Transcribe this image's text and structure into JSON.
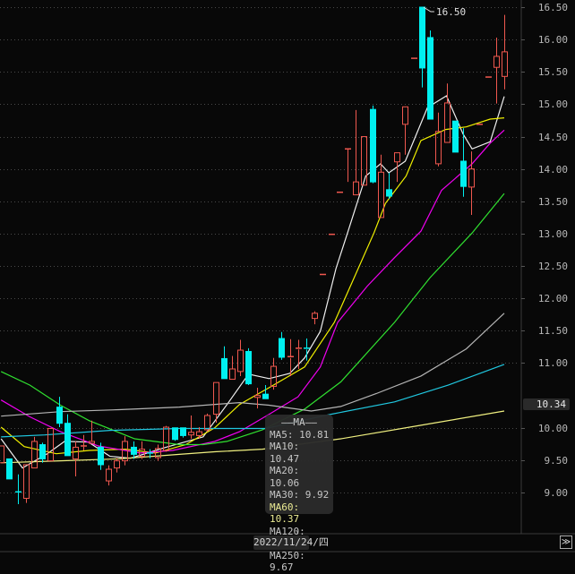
{
  "chart_data": {
    "type": "candlestick",
    "ylim": [
      8.7,
      16.62
    ],
    "yticks": [
      "16.50",
      "16.00",
      "15.50",
      "15.00",
      "14.50",
      "14.00",
      "13.50",
      "13.00",
      "12.50",
      "12.00",
      "11.50",
      "11.00",
      "10.00",
      "9.50",
      "9.00"
    ],
    "grid": true,
    "colors": {
      "up": "#f0584f",
      "down": "#00f0f0",
      "background": "#080808",
      "grid": "#4a4a4a"
    },
    "candles_ohlc": [
      [
        9.46,
        9.72,
        9.46,
        9.72
      ],
      [
        9.52,
        9.52,
        9.21,
        9.21
      ],
      [
        9.01,
        9.28,
        8.82,
        9.0
      ],
      [
        8.91,
        9.43,
        8.84,
        9.43
      ],
      [
        9.38,
        9.86,
        9.38,
        9.79
      ],
      [
        9.74,
        9.77,
        9.46,
        9.52
      ],
      [
        9.49,
        9.99,
        9.49,
        9.99
      ],
      [
        10.32,
        10.48,
        10.01,
        10.07
      ],
      [
        10.07,
        10.21,
        9.57,
        9.57
      ],
      [
        9.52,
        9.79,
        9.25,
        9.7
      ],
      [
        9.71,
        9.89,
        9.65,
        9.72
      ],
      [
        9.76,
        10.11,
        9.76,
        9.79
      ],
      [
        9.7,
        9.77,
        9.35,
        9.43
      ],
      [
        9.18,
        9.42,
        9.11,
        9.36
      ],
      [
        9.38,
        9.53,
        9.31,
        9.49
      ],
      [
        9.49,
        9.87,
        9.42,
        9.79
      ],
      [
        9.7,
        9.79,
        9.52,
        9.59
      ],
      [
        9.56,
        9.79,
        9.52,
        9.67
      ],
      [
        9.61,
        9.67,
        9.53,
        9.6
      ],
      [
        9.54,
        9.74,
        9.49,
        9.68
      ],
      [
        9.65,
        10.03,
        9.63,
        10.01
      ],
      [
        10.0,
        10.0,
        9.8,
        9.82
      ],
      [
        10.0,
        10.0,
        9.85,
        9.88
      ],
      [
        9.89,
        10.19,
        9.83,
        9.93
      ],
      [
        9.88,
        10.01,
        9.83,
        9.94
      ],
      [
        9.97,
        10.22,
        9.94,
        10.19
      ],
      [
        10.21,
        10.7,
        10.08,
        10.7
      ],
      [
        11.07,
        11.26,
        10.76,
        10.76
      ],
      [
        10.75,
        11.11,
        10.75,
        10.91
      ],
      [
        10.87,
        11.36,
        10.8,
        11.2
      ],
      [
        11.18,
        11.23,
        10.66,
        10.68
      ],
      [
        10.47,
        10.62,
        10.3,
        10.5
      ],
      [
        10.52,
        10.66,
        10.45,
        10.45
      ],
      [
        10.64,
        11.08,
        10.59,
        10.95
      ],
      [
        11.38,
        11.48,
        11.05,
        11.09
      ],
      [
        11.08,
        11.37,
        10.8,
        11.1
      ],
      [
        11.21,
        11.36,
        10.91,
        11.23
      ],
      [
        11.23,
        11.38,
        11.04,
        11.21
      ],
      [
        11.69,
        11.8,
        11.6,
        11.77
      ],
      [
        12.37,
        12.37,
        12.37,
        12.37
      ],
      [
        12.99,
        12.99,
        12.99,
        12.99
      ],
      [
        13.64,
        13.64,
        13.64,
        13.64
      ],
      [
        14.3,
        14.31,
        13.8,
        14.31
      ],
      [
        13.6,
        14.91,
        13.6,
        13.8
      ],
      [
        13.75,
        14.5,
        13.75,
        14.5
      ],
      [
        14.92,
        14.98,
        13.78,
        13.8
      ],
      [
        13.25,
        14.22,
        13.25,
        13.95
      ],
      [
        13.68,
        13.94,
        13.54,
        13.58
      ],
      [
        14.11,
        14.25,
        13.8,
        14.25
      ],
      [
        14.69,
        14.96,
        14.22,
        14.96
      ],
      [
        15.71,
        15.71,
        15.71,
        15.71
      ],
      [
        16.5,
        16.5,
        15.26,
        15.56
      ],
      [
        16.03,
        16.14,
        14.77,
        14.77
      ],
      [
        14.08,
        14.87,
        14.04,
        14.58
      ],
      [
        14.41,
        15.32,
        14.41,
        15.02
      ],
      [
        14.74,
        14.74,
        14.26,
        14.26
      ],
      [
        14.12,
        14.63,
        13.57,
        13.73
      ],
      [
        13.72,
        14.27,
        13.29,
        14.0
      ],
      [
        14.69,
        14.69,
        14.69,
        14.69
      ],
      [
        15.42,
        15.42,
        15.42,
        15.42
      ],
      [
        15.57,
        16.03,
        15.01,
        15.74
      ],
      [
        15.43,
        16.38,
        15.23,
        15.81
      ]
    ],
    "moving_averages": [
      {
        "name": "MA5",
        "color": "#f0f0f0",
        "points": [
          [
            0,
            9.83
          ],
          [
            2.6,
            9.38
          ],
          [
            5.6,
            9.6
          ],
          [
            7.7,
            9.79
          ],
          [
            10.6,
            9.78
          ],
          [
            13.2,
            9.56
          ],
          [
            15.7,
            9.53
          ],
          [
            20,
            9.7
          ],
          [
            24.5,
            9.86
          ],
          [
            27.4,
            10.36
          ],
          [
            30,
            10.83
          ],
          [
            32.5,
            10.76
          ],
          [
            35,
            10.84
          ],
          [
            36.8,
            11.08
          ],
          [
            38.7,
            11.49
          ],
          [
            40.6,
            12.46
          ],
          [
            42,
            13.01
          ],
          [
            44.2,
            13.89
          ],
          [
            46,
            14.08
          ],
          [
            47,
            13.94
          ],
          [
            49,
            14.12
          ],
          [
            51.7,
            14.95
          ],
          [
            54,
            15.13
          ],
          [
            56,
            14.54
          ],
          [
            57.1,
            14.31
          ],
          [
            59.3,
            14.42
          ],
          [
            61,
            15.12
          ]
        ]
      },
      {
        "name": "MA10",
        "color": "#f0f000",
        "points": [
          [
            0,
            10.01
          ],
          [
            2.8,
            9.71
          ],
          [
            6.7,
            9.6
          ],
          [
            10.7,
            9.65
          ],
          [
            15.1,
            9.67
          ],
          [
            18.7,
            9.61
          ],
          [
            22.4,
            9.74
          ],
          [
            25.9,
            10.0
          ],
          [
            28.9,
            10.36
          ],
          [
            32.5,
            10.62
          ],
          [
            36.8,
            10.94
          ],
          [
            40.4,
            11.63
          ],
          [
            42.8,
            12.32
          ],
          [
            45.2,
            13.01
          ],
          [
            46.6,
            13.47
          ],
          [
            49.1,
            13.89
          ],
          [
            50.9,
            14.44
          ],
          [
            53.9,
            14.61
          ],
          [
            56.4,
            14.65
          ],
          [
            59.3,
            14.77
          ],
          [
            61,
            14.79
          ]
        ]
      },
      {
        "name": "MA20",
        "color": "#f000f0",
        "points": [
          [
            0,
            10.43
          ],
          [
            3.5,
            10.17
          ],
          [
            7.2,
            9.94
          ],
          [
            11.8,
            9.72
          ],
          [
            16.9,
            9.61
          ],
          [
            20.8,
            9.65
          ],
          [
            25.9,
            9.79
          ],
          [
            28.9,
            9.94
          ],
          [
            32.5,
            10.21
          ],
          [
            36,
            10.48
          ],
          [
            38.7,
            10.94
          ],
          [
            40.8,
            11.63
          ],
          [
            44.4,
            12.19
          ],
          [
            47.7,
            12.63
          ],
          [
            50.9,
            13.04
          ],
          [
            53.4,
            13.67
          ],
          [
            57.1,
            14.08
          ],
          [
            59.3,
            14.4
          ],
          [
            61,
            14.6
          ]
        ]
      },
      {
        "name": "MA30",
        "color": "#30e030",
        "points": [
          [
            0,
            10.87
          ],
          [
            3.5,
            10.66
          ],
          [
            7.2,
            10.35
          ],
          [
            10.7,
            10.11
          ],
          [
            16.2,
            9.83
          ],
          [
            21.6,
            9.74
          ],
          [
            24.5,
            9.74
          ],
          [
            27.4,
            9.79
          ],
          [
            31.7,
            9.97
          ],
          [
            36.8,
            10.29
          ],
          [
            41.2,
            10.71
          ],
          [
            47.7,
            11.63
          ],
          [
            52,
            12.32
          ],
          [
            57.1,
            13.01
          ],
          [
            61,
            13.62
          ]
        ]
      },
      {
        "name": "MA60",
        "color": "#b4b4b4",
        "points": [
          [
            0,
            10.18
          ],
          [
            7.2,
            10.25
          ],
          [
            14.3,
            10.28
          ],
          [
            21.6,
            10.32
          ],
          [
            28.9,
            10.39
          ],
          [
            32.5,
            10.35
          ],
          [
            37.6,
            10.26
          ],
          [
            41.2,
            10.33
          ],
          [
            45.5,
            10.53
          ],
          [
            50.9,
            10.8
          ],
          [
            56.4,
            11.22
          ],
          [
            61,
            11.77
          ]
        ]
      },
      {
        "name": "MA120",
        "color": "#20c8e0",
        "points": [
          [
            0,
            9.86
          ],
          [
            5.3,
            9.89
          ],
          [
            13.2,
            9.96
          ],
          [
            21.6,
            9.99
          ],
          [
            32.1,
            9.99
          ],
          [
            40,
            10.21
          ],
          [
            47.7,
            10.4
          ],
          [
            54.2,
            10.66
          ],
          [
            61,
            10.98
          ]
        ]
      },
      {
        "name": "MA250",
        "color": "#f0f080",
        "points": [
          [
            0,
            9.46
          ],
          [
            7.2,
            9.49
          ],
          [
            14.3,
            9.52
          ],
          [
            21.6,
            9.59
          ],
          [
            25.9,
            9.63
          ],
          [
            31.7,
            9.67
          ],
          [
            41.2,
            9.83
          ],
          [
            50.9,
            10.04
          ],
          [
            61,
            10.26
          ]
        ]
      }
    ],
    "max_annotation": "16.50",
    "current_price": "10.34",
    "x_date_label": "2022/11/24/四"
  },
  "tooltip": {
    "title": "——MA——",
    "rows": [
      "MA5: 10.81",
      "MA10: 10.47",
      "MA20: 10.06",
      "MA30: 9.92",
      "MA60: 10.37",
      "MA120: 9.99",
      "MA250: 9.67"
    ]
  },
  "scroll_button": "≫"
}
